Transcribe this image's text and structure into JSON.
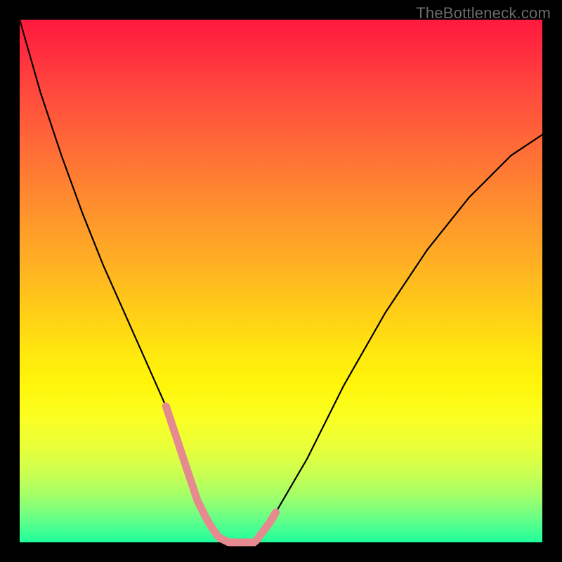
{
  "watermark": "TheBottleneck.com",
  "chart_data": {
    "type": "line",
    "title": "",
    "xlabel": "",
    "ylabel": "",
    "xlim": [
      0,
      100
    ],
    "ylim": [
      0,
      100
    ],
    "grid": false,
    "legend": false,
    "series": [
      {
        "name": "curve",
        "x": [
          0,
          4,
          8,
          12,
          16,
          20,
          24,
          28,
          30,
          32,
          34,
          36,
          38,
          40,
          42,
          45,
          48,
          55,
          62,
          70,
          78,
          86,
          94,
          100
        ],
        "values": [
          100,
          86,
          74,
          63,
          53,
          44,
          35,
          26,
          20,
          14,
          8,
          4,
          1,
          0,
          0,
          0,
          4,
          16,
          30,
          44,
          56,
          66,
          74,
          78
        ]
      }
    ],
    "highlight_ranges": [
      {
        "name": "pink-left-descent",
        "xstart": 28,
        "xend": 37
      },
      {
        "name": "pink-bottom-flat",
        "xstart": 37,
        "xend": 44
      },
      {
        "name": "pink-right-ascent",
        "xstart": 44,
        "xend": 49
      }
    ],
    "colors": {
      "curve": "#000000",
      "highlight": "#e58a8f",
      "background_top": "#ff193f",
      "background_bottom": "#1fff9c",
      "frame": "#000000",
      "watermark_text": "#6b6b6b"
    }
  }
}
